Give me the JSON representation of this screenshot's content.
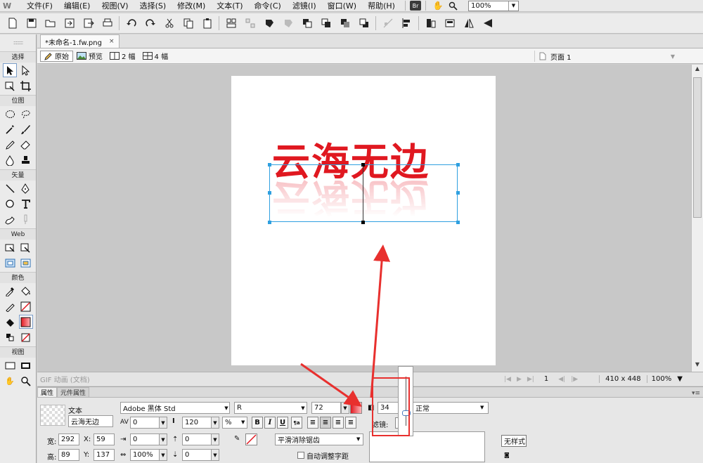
{
  "menubar": {
    "app_logo": "W",
    "items": [
      "文件(F)",
      "编辑(E)",
      "视图(V)",
      "选择(S)",
      "修改(M)",
      "文本(T)",
      "命令(C)",
      "滤镜(I)",
      "窗口(W)",
      "帮助(H)"
    ],
    "br_label": "Br",
    "zoom_value": "100%"
  },
  "tools": {
    "sections": [
      "选择",
      "位图",
      "矢量",
      "Web",
      "颜色",
      "视图"
    ]
  },
  "document": {
    "tab_title": "*未命名-1.fw.png",
    "tab_close": "×",
    "view_modes": [
      "原始",
      "预览",
      "2 幅",
      "4 幅"
    ],
    "page_label": "页面 1",
    "artboard_text": "云海无边",
    "status_gif": "GIF 动画 (文档)",
    "status_frame": "1",
    "status_dims": "410 x 448",
    "status_zoom": "100%"
  },
  "properties": {
    "tabs": [
      "属性",
      "元件属性"
    ],
    "type_label": "文本",
    "text_name": "云海无边",
    "font_family": "Adobe 黑体 Std",
    "font_style": "R",
    "font_size": "72",
    "kerning": "0",
    "leading": "120",
    "leading_unit": "%",
    "bold": "B",
    "italic": "I",
    "underline": "U",
    "opacity": "34",
    "blend_mode": "正常",
    "filter_label": "滤镜:",
    "width_label": "宽:",
    "width": "292",
    "height_label": "高:",
    "height": "89",
    "x_label": "X:",
    "x": "59",
    "y_label": "Y:",
    "y": "137",
    "indent": "0",
    "space_before": "0",
    "space_after": "0",
    "horiz_scale": "100%",
    "baseline_shift": "0",
    "antialias": "平滑消除锯齿",
    "auto_kern": "自动调整字距",
    "style_btn": "无样式"
  },
  "colors": {
    "text_red": "#e01820",
    "selection_blue": "#2fa0e0",
    "annotation_red": "#e8302e"
  }
}
